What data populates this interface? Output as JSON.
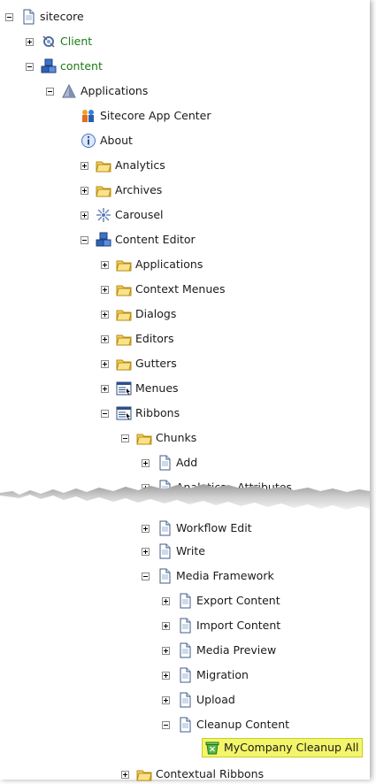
{
  "tree": {
    "nodes": [
      {
        "label": "sitecore",
        "toggle": "minus",
        "icon": "page-icon"
      },
      {
        "label": "Client",
        "toggle": "plus",
        "icon": "client-icon",
        "color": "#1d7a16"
      },
      {
        "label": "content",
        "toggle": "minus",
        "icon": "cubes-icon",
        "color": "#1d7a16"
      },
      {
        "label": "Applications",
        "toggle": "minus",
        "icon": "applications-icon"
      },
      {
        "label": "Sitecore App Center",
        "toggle": "none",
        "icon": "people-icon"
      },
      {
        "label": "About",
        "toggle": "none",
        "icon": "info-icon"
      },
      {
        "label": "Analytics",
        "toggle": "plus",
        "icon": "folder-icon"
      },
      {
        "label": "Archives",
        "toggle": "plus",
        "icon": "folder-icon"
      },
      {
        "label": "Carousel",
        "toggle": "plus",
        "icon": "carousel-icon"
      },
      {
        "label": "Content Editor",
        "toggle": "minus",
        "icon": "cubes-icon"
      },
      {
        "label": "Applications",
        "toggle": "plus",
        "icon": "folder-icon"
      },
      {
        "label": "Context Menues",
        "toggle": "plus",
        "icon": "folder-icon"
      },
      {
        "label": "Dialogs",
        "toggle": "plus",
        "icon": "folder-icon"
      },
      {
        "label": "Editors",
        "toggle": "plus",
        "icon": "folder-icon"
      },
      {
        "label": "Gutters",
        "toggle": "plus",
        "icon": "folder-icon"
      },
      {
        "label": "Menues",
        "toggle": "plus",
        "icon": "menu-icon"
      },
      {
        "label": "Ribbons",
        "toggle": "minus",
        "icon": "menu-icon"
      },
      {
        "label": "Chunks",
        "toggle": "minus",
        "icon": "folder-icon"
      },
      {
        "label": "Add",
        "toggle": "plus",
        "icon": "page-icon"
      },
      {
        "label": "Analytics - Attributes",
        "toggle": "plus",
        "icon": "page-icon"
      },
      {
        "label": "Workflow Edit",
        "toggle": "plus",
        "icon": "page-icon"
      },
      {
        "label": "Write",
        "toggle": "plus",
        "icon": "page-icon"
      },
      {
        "label": "Media Framework",
        "toggle": "minus",
        "icon": "page-icon"
      },
      {
        "label": "Export Content",
        "toggle": "plus",
        "icon": "page-icon"
      },
      {
        "label": "Import Content",
        "toggle": "plus",
        "icon": "page-icon"
      },
      {
        "label": "Media Preview",
        "toggle": "plus",
        "icon": "page-icon"
      },
      {
        "label": "Migration",
        "toggle": "plus",
        "icon": "page-icon"
      },
      {
        "label": "Upload",
        "toggle": "plus",
        "icon": "page-icon"
      },
      {
        "label": "Cleanup Content",
        "toggle": "minus",
        "icon": "page-icon"
      },
      {
        "label": "MyCompany Cleanup All",
        "toggle": "none",
        "icon": "cleanup-icon",
        "selected": true
      },
      {
        "label": "Contextual Ribbons",
        "toggle": "plus",
        "icon": "folder-icon"
      }
    ]
  },
  "colors": {
    "selected_bg": "#f3f56a",
    "accent_green": "#1d7a16"
  }
}
